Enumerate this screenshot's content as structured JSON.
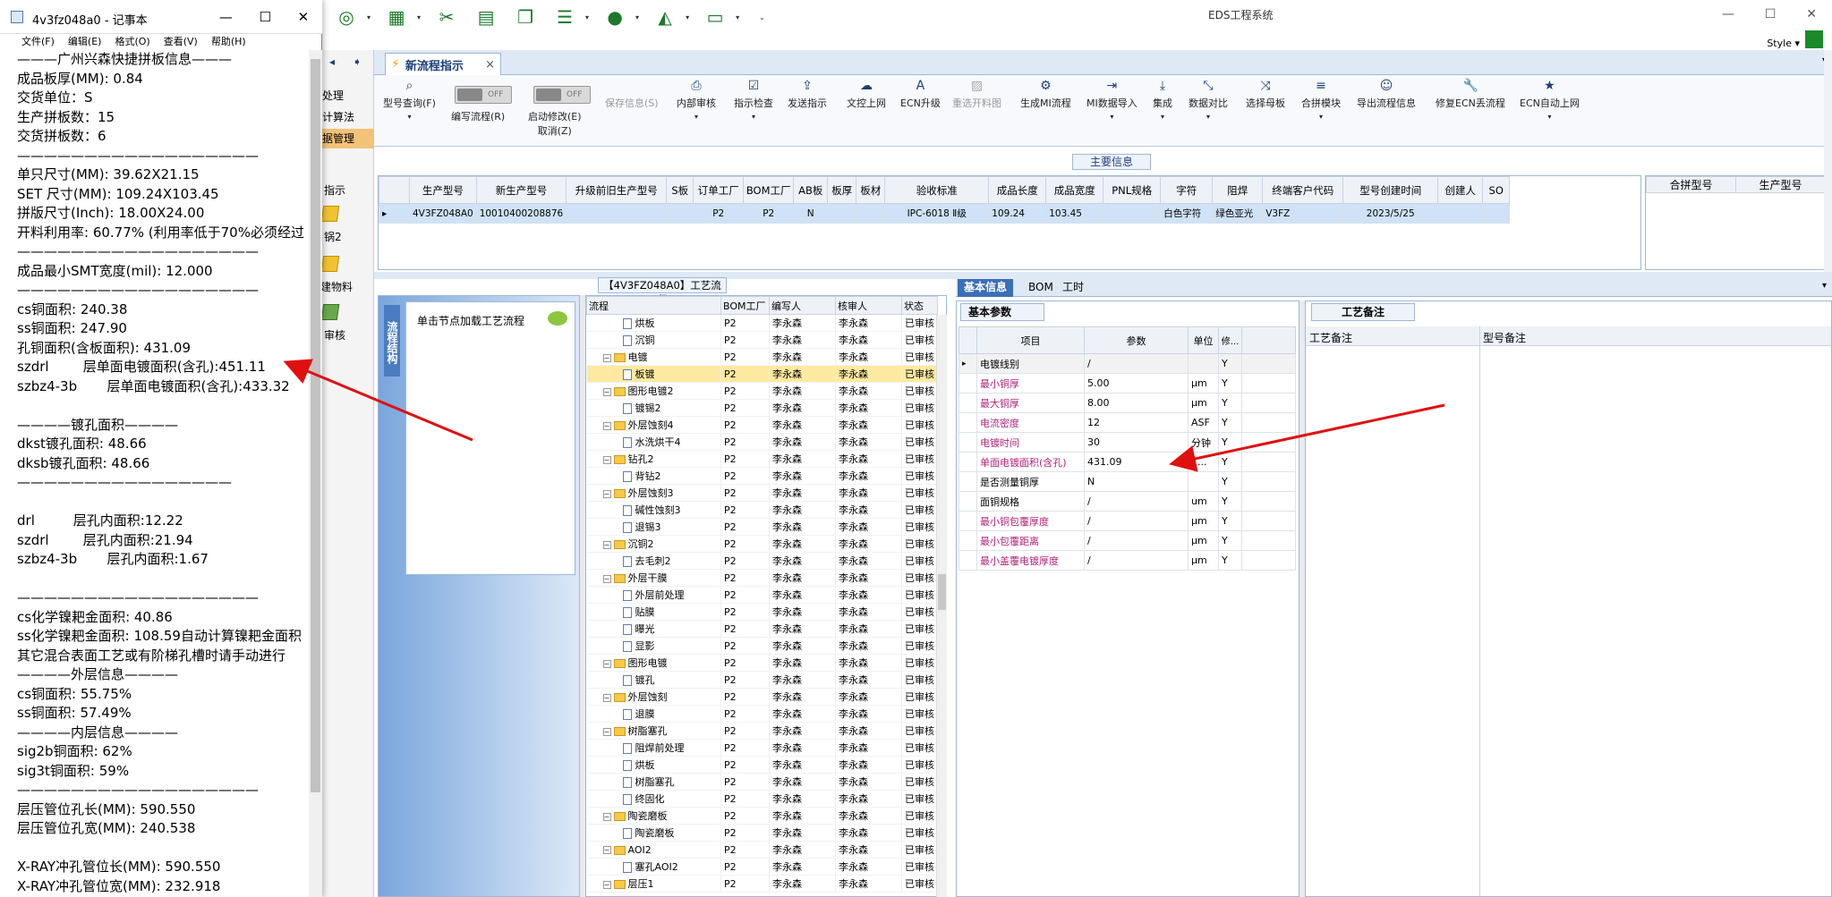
{
  "app": {
    "title": "EDS工程系统",
    "style_label": "Style",
    "window_buttons": [
      "—",
      "☐",
      "✕"
    ]
  },
  "quick_access": [
    "ring-icon",
    "table-icon",
    "scissors-icon",
    "film-icon",
    "copy-icon",
    "list-icon",
    "user-icon",
    "chart-icon",
    "monitor-icon"
  ],
  "left_nav": {
    "items": [
      "处理",
      "计算法",
      "据管理",
      "指示",
      "锅2",
      "建物料",
      "审核"
    ]
  },
  "doc_tab": {
    "label": "新流程指示",
    "close": "×"
  },
  "ribbon": {
    "toggle_off": "OFF",
    "buttons": [
      {
        "label": "型号查询(F)"
      },
      {
        "label": "编写流程(R)"
      },
      {
        "label": "启动修改(E)",
        "label2": "取消(Z)"
      },
      {
        "label": "保存信息(S)",
        "disabled": true
      },
      {
        "label": "内部审核"
      },
      {
        "label": "指示检查"
      },
      {
        "label": "发送指示"
      },
      {
        "label": "文控上网"
      },
      {
        "label": "ECN升级"
      },
      {
        "label": "重选开料图",
        "disabled": true
      },
      {
        "label": "生成MI流程"
      },
      {
        "label": "MI数据导入"
      },
      {
        "label": "集成"
      },
      {
        "label": "数据对比"
      },
      {
        "label": "选择母板"
      },
      {
        "label": "合拼模块"
      },
      {
        "label": "导出流程信息"
      },
      {
        "label": "修复ECN丢流程"
      },
      {
        "label": "ECN自动上网"
      }
    ]
  },
  "main_info": {
    "title": "主要信息",
    "columns": [
      "生产型号",
      "新生产型号",
      "升级前旧生产型号",
      "S板",
      "订单工厂",
      "BOM工厂",
      "AB板",
      "板厚",
      "板材",
      "验收标准",
      "成品长度",
      "成品宽度",
      "PNL规格",
      "字符",
      "阻焊",
      "终端客户代码",
      "型号创建时间",
      "创建人",
      "SO"
    ],
    "row": [
      "4V3FZ048A0",
      "10010400208876",
      "",
      "",
      "P2",
      "P2",
      "N",
      "",
      "",
      "IPC-6018 Ⅱ级",
      "109.24",
      "103.45",
      "",
      "白色字符",
      "绿色亚光",
      "V3FZ",
      "2023/5/25",
      "",
      ""
    ],
    "side_columns": [
      "合拼型号",
      "生产型号"
    ]
  },
  "process_flow": {
    "title": "【4V3FZ048A0】工艺流程",
    "vertical_tab": "流程结构",
    "hint": "单击节点加载工艺流程",
    "columns": [
      "流程",
      "BOM工厂",
      "编写人",
      "核审人",
      "状态"
    ],
    "rows": [
      {
        "name": "烘板",
        "level": 2,
        "bom": "P2",
        "writer": "李永森",
        "reviewer": "李永森",
        "status": "已审核"
      },
      {
        "name": "沉铜",
        "level": 2,
        "bom": "P2",
        "writer": "李永森",
        "reviewer": "李永森",
        "status": "已审核"
      },
      {
        "name": "电镀",
        "level": 1,
        "bom": "P2",
        "writer": "李永森",
        "reviewer": "李永森",
        "status": "已审核"
      },
      {
        "name": "板镀",
        "level": 2,
        "bom": "P2",
        "writer": "李永森",
        "reviewer": "李永森",
        "status": "已审核",
        "highlight": true
      },
      {
        "name": "图形电镀2",
        "level": 1,
        "bom": "P2",
        "writer": "李永森",
        "reviewer": "李永森",
        "status": "已审核"
      },
      {
        "name": "镀锡2",
        "level": 2,
        "bom": "P2",
        "writer": "李永森",
        "reviewer": "李永森",
        "status": "已审核"
      },
      {
        "name": "外层蚀刻4",
        "level": 1,
        "bom": "P2",
        "writer": "李永森",
        "reviewer": "李永森",
        "status": "已审核"
      },
      {
        "name": "水洗烘干4",
        "level": 2,
        "bom": "P2",
        "writer": "李永森",
        "reviewer": "李永森",
        "status": "已审核"
      },
      {
        "name": "钻孔2",
        "level": 1,
        "bom": "P2",
        "writer": "李永森",
        "reviewer": "李永森",
        "status": "已审核"
      },
      {
        "name": "背钻2",
        "level": 2,
        "bom": "P2",
        "writer": "李永森",
        "reviewer": "李永森",
        "status": "已审核"
      },
      {
        "name": "外层蚀刻3",
        "level": 1,
        "bom": "P2",
        "writer": "李永森",
        "reviewer": "李永森",
        "status": "已审核"
      },
      {
        "name": "碱性蚀刻3",
        "level": 2,
        "bom": "P2",
        "writer": "李永森",
        "reviewer": "李永森",
        "status": "已审核"
      },
      {
        "name": "退锡3",
        "level": 2,
        "bom": "P2",
        "writer": "李永森",
        "reviewer": "李永森",
        "status": "已审核"
      },
      {
        "name": "沉铜2",
        "level": 1,
        "bom": "P2",
        "writer": "李永森",
        "reviewer": "李永森",
        "status": "已审核"
      },
      {
        "name": "去毛刺2",
        "level": 2,
        "bom": "P2",
        "writer": "李永森",
        "reviewer": "李永森",
        "status": "已审核"
      },
      {
        "name": "外层干膜",
        "level": 1,
        "bom": "P2",
        "writer": "李永森",
        "reviewer": "李永森",
        "status": "已审核"
      },
      {
        "name": "外层前处理",
        "level": 2,
        "bom": "P2",
        "writer": "李永森",
        "reviewer": "李永森",
        "status": "已审核"
      },
      {
        "name": "贴膜",
        "level": 2,
        "bom": "P2",
        "writer": "李永森",
        "reviewer": "李永森",
        "status": "已审核"
      },
      {
        "name": "曝光",
        "level": 2,
        "bom": "P2",
        "writer": "李永森",
        "reviewer": "李永森",
        "status": "已审核"
      },
      {
        "name": "显影",
        "level": 2,
        "bom": "P2",
        "writer": "李永森",
        "reviewer": "李永森",
        "status": "已审核"
      },
      {
        "name": "图形电镀",
        "level": 1,
        "bom": "P2",
        "writer": "李永森",
        "reviewer": "李永森",
        "status": "已审核"
      },
      {
        "name": "镀孔",
        "level": 2,
        "bom": "P2",
        "writer": "李永森",
        "reviewer": "李永森",
        "status": "已审核"
      },
      {
        "name": "外层蚀刻",
        "level": 1,
        "bom": "P2",
        "writer": "李永森",
        "reviewer": "李永森",
        "status": "已审核"
      },
      {
        "name": "退膜",
        "level": 2,
        "bom": "P2",
        "writer": "李永森",
        "reviewer": "李永森",
        "status": "已审核"
      },
      {
        "name": "树脂塞孔",
        "level": 1,
        "bom": "P2",
        "writer": "李永森",
        "reviewer": "李永森",
        "status": "已审核"
      },
      {
        "name": "阻焊前处理",
        "level": 2,
        "bom": "P2",
        "writer": "李永森",
        "reviewer": "李永森",
        "status": "已审核"
      },
      {
        "name": "烘板",
        "level": 2,
        "bom": "P2",
        "writer": "李永森",
        "reviewer": "李永森",
        "status": "已审核"
      },
      {
        "name": "树脂塞孔",
        "level": 2,
        "bom": "P2",
        "writer": "李永森",
        "reviewer": "李永森",
        "status": "已审核"
      },
      {
        "name": "终固化",
        "level": 2,
        "bom": "P2",
        "writer": "李永森",
        "reviewer": "李永森",
        "status": "已审核"
      },
      {
        "name": "陶瓷磨板",
        "level": 1,
        "bom": "P2",
        "writer": "李永森",
        "reviewer": "李永森",
        "status": "已审核"
      },
      {
        "name": "陶瓷磨板",
        "level": 2,
        "bom": "P2",
        "writer": "李永森",
        "reviewer": "李永森",
        "status": "已审核"
      },
      {
        "name": "AOI2",
        "level": 1,
        "bom": "P2",
        "writer": "李永森",
        "reviewer": "李永森",
        "status": "已审核"
      },
      {
        "name": "塞孔AOI2",
        "level": 2,
        "bom": "P2",
        "writer": "李永森",
        "reviewer": "李永森",
        "status": "已审核"
      },
      {
        "name": "层压1",
        "level": 1,
        "bom": "P2",
        "writer": "李永森",
        "reviewer": "李永森",
        "status": "已审核"
      }
    ]
  },
  "info_tabs": [
    "基本信息",
    "BOM",
    "工时"
  ],
  "basic_params": {
    "title": "基本参数",
    "columns": [
      "项目",
      "参数",
      "单位",
      "修..."
    ],
    "rows": [
      {
        "item": "电镀线别",
        "value": "/",
        "unit": "",
        "flag": "Y",
        "pink": false,
        "current": true
      },
      {
        "item": "最小铜厚",
        "value": "5.00",
        "unit": "μm",
        "flag": "Y",
        "pink": true
      },
      {
        "item": "最大铜厚",
        "value": "8.00",
        "unit": "μm",
        "flag": "Y",
        "pink": true
      },
      {
        "item": "电流密度",
        "value": "12",
        "unit": "ASF",
        "flag": "Y",
        "pink": true
      },
      {
        "item": "电镀时间",
        "value": "30",
        "unit": "分钟",
        "flag": "Y",
        "pink": true
      },
      {
        "item": "单面电镀面积(含孔)",
        "value": "431.09",
        "unit": "1...",
        "flag": "Y",
        "pink": true
      },
      {
        "item": "是否测量铜厚",
        "value": "N",
        "unit": "",
        "flag": "Y",
        "pink": false
      },
      {
        "item": "面铜规格",
        "value": "/",
        "unit": "um",
        "flag": "Y",
        "pink": false
      },
      {
        "item": "最小铜包覆厚度",
        "value": "/",
        "unit": "μm",
        "flag": "Y",
        "pink": true
      },
      {
        "item": "最小包覆距离",
        "value": "/",
        "unit": "μm",
        "flag": "Y",
        "pink": true
      },
      {
        "item": "最小盖覆电镀厚度",
        "value": "/",
        "unit": "μm",
        "flag": "Y",
        "pink": true
      }
    ]
  },
  "process_memo": {
    "title": "工艺备注",
    "columns": [
      "工艺备注",
      "型号备注"
    ]
  },
  "notepad": {
    "title": "4v3fz048a0 - 记事本",
    "menu": [
      "文件(F)",
      "编辑(E)",
      "格式(O)",
      "查看(V)",
      "帮助(H)"
    ],
    "lines": [
      "———广州兴森快捷拼板信息———",
      "成品板厚(MM): 0.84",
      "交货单位：S",
      "生产拼板数：15",
      "交货拼板数：6",
      "——————————————————",
      "单只尺寸(MM): 39.62X21.15",
      "SET 尺寸(MM): 109.24X103.45",
      "拼版尺寸(Inch): 18.00X24.00",
      "开料利用率: 60.77% (利用率低于70%必须经过",
      "——————————————————",
      "成品最小SMT宽度(mil): 12.000",
      "——————————————————",
      "cs铜面积: 240.38",
      "ss铜面积: 247.90",
      "孔铜面积(含板面积): 431.09",
      "szdrl        层单面电镀面积(含孔):451.11",
      "szbz4-3b       层单面电镀面积(含孔):433.32",
      "",
      "————镀孔面积————",
      "dkst镀孔面积: 48.66",
      "dksb镀孔面积: 48.66",
      "————————————————",
      "",
      "drl         层孔内面积:12.22",
      "szdrl        层孔内面积:21.94",
      "szbz4-3b       层孔内面积:1.67",
      "",
      "——————————————————",
      "cs化学镍耙金面积: 40.86",
      "ss化学镍耙金面积: 108.59自动计算镍耙金面积",
      "其它混合表面工艺或有阶梯孔槽时请手动进行",
      "————外层信息————",
      "cs铜面积: 55.75%",
      "ss铜面积: 57.49%",
      "————内层信息————",
      "sig2b铜面积: 62%",
      "sig3t铜面积: 59%",
      "——————————————————",
      "层压管位孔长(MM): 590.550",
      "层压管位孔宽(MM): 240.538",
      "",
      "X-RAY冲孔管位长(MM): 590.550",
      "X-RAY冲孔管位宽(MM): 232.918"
    ]
  },
  "colors": {
    "annotation_arrow": "#e01010",
    "accent": "#3b6fb6",
    "highlight_row": "#fdeaa0",
    "pink_text": "#b2237a"
  }
}
